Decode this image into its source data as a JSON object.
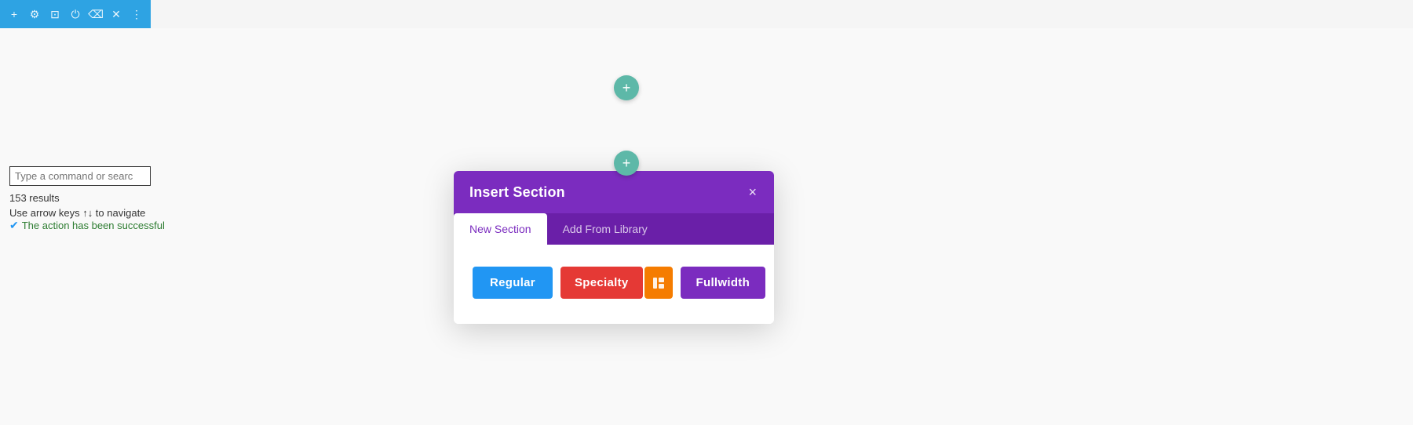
{
  "toolbar": {
    "icons": [
      {
        "name": "add-icon",
        "symbol": "+"
      },
      {
        "name": "settings-icon",
        "symbol": "⚙"
      },
      {
        "name": "layout-icon",
        "symbol": "⊞"
      },
      {
        "name": "power-icon",
        "symbol": "⏻"
      },
      {
        "name": "trash-icon",
        "symbol": "🗑"
      },
      {
        "name": "close-icon",
        "symbol": "✕"
      },
      {
        "name": "more-icon",
        "symbol": "⋮"
      }
    ]
  },
  "add_buttons": {
    "top_label": "+",
    "active_label": "+"
  },
  "command": {
    "placeholder": "Type a command or searc",
    "results_count": "153 results",
    "nav_hint": "Use arrow keys ↑↓ to navigate",
    "success_text": "The action has been successful"
  },
  "modal": {
    "title": "Insert Section",
    "close_label": "×",
    "tabs": [
      {
        "label": "New Section",
        "active": true
      },
      {
        "label": "Add From Library",
        "active": false
      }
    ],
    "buttons": {
      "regular": "Regular",
      "specialty": "Specialty",
      "specialty_icon": "□",
      "fullwidth": "Fullwidth"
    }
  },
  "colors": {
    "toolbar_bg": "#2ea3e3",
    "add_btn": "#5db8a8",
    "modal_header": "#7b2cbf",
    "modal_tab_bg": "#6a1fa8",
    "btn_regular": "#2196f3",
    "btn_specialty": "#e53935",
    "btn_specialty_icon": "#f57c00",
    "btn_fullwidth": "#7b2cbf"
  }
}
